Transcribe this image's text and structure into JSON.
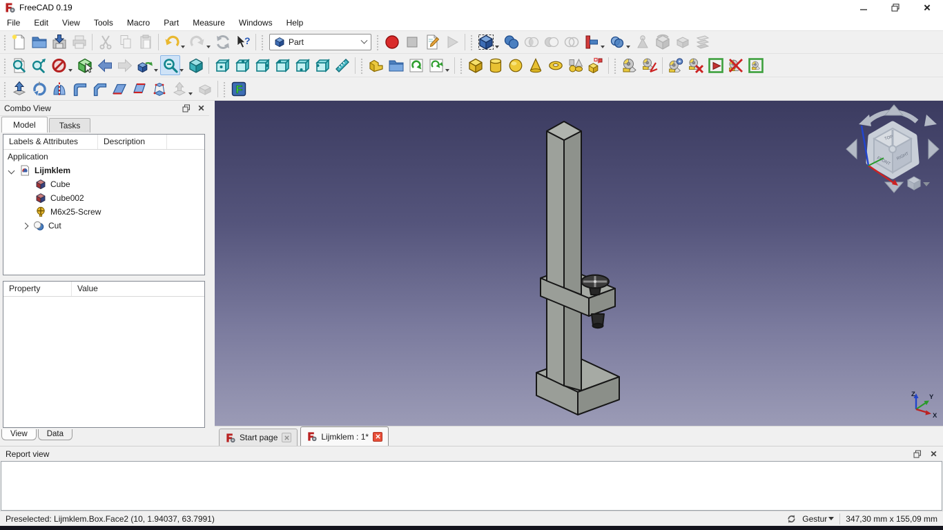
{
  "window": {
    "title": "FreeCAD 0.19",
    "controls": [
      "minimize",
      "restore",
      "close"
    ]
  },
  "menu": {
    "items": [
      "File",
      "Edit",
      "View",
      "Tools",
      "Macro",
      "Part",
      "Measure",
      "Windows",
      "Help"
    ]
  },
  "toolbars": {
    "workbench_selector": {
      "value": "Part",
      "icon": "part-workbench-icon"
    },
    "row1_icons": [
      "new-document",
      "open-document",
      "save-document",
      "print",
      "cut",
      "copy",
      "paste",
      "undo",
      "redo",
      "refresh",
      "whats-this",
      "macro-record",
      "macro-stop",
      "macro-edit",
      "macro-play",
      "part-compound",
      "part-boolean-union",
      "part-boolean-intersection",
      "part-boolean-difference",
      "part-boolean-xor",
      "part-join",
      "part-split",
      "part-defeaturing",
      "part-mirror-3d",
      "part-thickness",
      "part-cross-sections"
    ],
    "row2_icons": [
      "fit-all",
      "fit-selection",
      "draw-style",
      "box-selection",
      "nav-back",
      "nav-forward",
      "link-navigate",
      "zoom-tools",
      "view-isometric",
      "view-front",
      "view-top",
      "view-right",
      "view-rear",
      "view-bottom",
      "view-left",
      "measure-distance",
      "create-part",
      "create-group",
      "make-link",
      "link-tools",
      "primitive-box",
      "primitive-cylinder",
      "primitive-sphere",
      "primitive-cone",
      "primitive-torus",
      "primitives-dialog",
      "shape-builder",
      "measure-linear",
      "measure-angular",
      "measure-refresh",
      "measure-clear-all",
      "toggle-all-measurements",
      "toggle-3d-measurement",
      "toggle-delta-measurement"
    ],
    "row3_icons": [
      "part-extrude",
      "part-revolve",
      "part-mirror",
      "part-fillet",
      "part-chamfer",
      "part-make-face",
      "part-ruled-surface",
      "part-loft",
      "part-sweep",
      "part-section",
      "macro-fcinfo"
    ]
  },
  "combo_view": {
    "title": "Combo View",
    "tabs": [
      {
        "label": "Model",
        "active": true
      },
      {
        "label": "Tasks",
        "active": false
      }
    ],
    "tree_headers": [
      "Labels & Attributes",
      "Description"
    ],
    "tree": {
      "root": "Application",
      "document": {
        "label": "Lijmklem",
        "expanded": true,
        "children": [
          {
            "label": "Cube",
            "icon": "part-box-icon"
          },
          {
            "label": "Cube002",
            "icon": "part-box-icon"
          },
          {
            "label": "M6x25-Screw",
            "icon": "screw-icon"
          },
          {
            "label": "Cut",
            "icon": "boolean-cut-icon",
            "has_children": true
          }
        ]
      }
    },
    "property_table": {
      "headers": [
        "Property",
        "Value"
      ],
      "rows": []
    },
    "bottom_tabs": [
      {
        "label": "View",
        "active": true
      },
      {
        "label": "Data",
        "active": false
      }
    ]
  },
  "viewport": {
    "document_tabs": [
      {
        "label": "Start page",
        "active": false,
        "close_icon": "close-icon"
      },
      {
        "label": "Lijmklem : 1*",
        "active": true,
        "close_icon": "close-icon-red"
      }
    ],
    "model_name": "Lijmklem glue clamp (column, arm with screw, base)",
    "nav_cube": {
      "face_labels": {
        "top": "TOP",
        "left": "FRONT",
        "right": "RIGHT"
      },
      "icons": [
        "rotate-left-arrow",
        "rotate-right-arrow",
        "pan-up-arrow",
        "pan-down-arrow",
        "pan-left-arrow",
        "pan-right-arrow",
        "mini-cube-menu"
      ]
    },
    "axis_indicator": {
      "x": "X",
      "y": "Y",
      "z": "Z"
    }
  },
  "report_view": {
    "title": "Report view",
    "content": ""
  },
  "status_bar": {
    "message": "Preselected: Lijmklem.Box.Face2 (10, 1.94037, 63.7991)",
    "nav_style": "Gestur",
    "dimensions": "347,30 mm x 155,09 mm"
  },
  "colors": {
    "viewport_top": "#3b3b60",
    "viewport_bottom": "#9b9bb6",
    "model_gray": "#9a9e98",
    "accent_blue": "#3d6db5",
    "record_red": "#d92b2b",
    "primitive_yellow": "#e8c133",
    "view_teal": "#2b97a0",
    "highlight": "#cfe3f7"
  }
}
